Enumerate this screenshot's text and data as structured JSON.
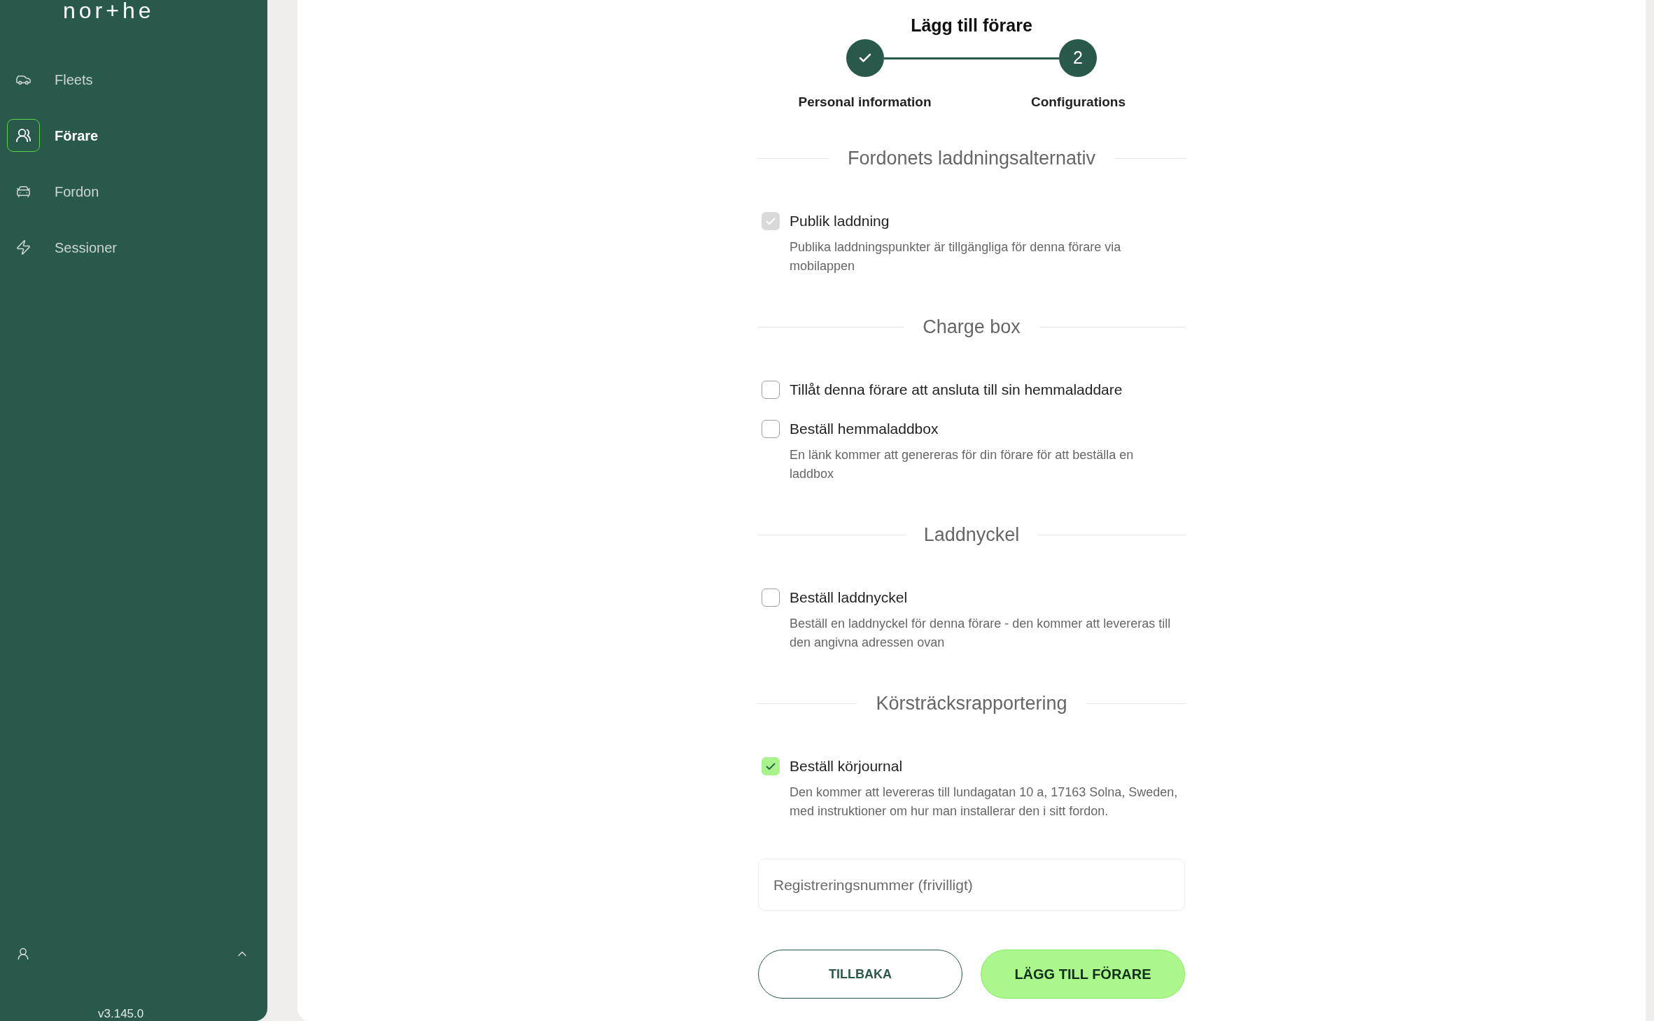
{
  "sidebar": {
    "logo": "nor+he",
    "items": [
      {
        "label": "Fleets",
        "selected": false
      },
      {
        "label": "Förare",
        "selected": true
      },
      {
        "label": "Fordon",
        "selected": false
      },
      {
        "label": "Sessioner",
        "selected": false
      }
    ],
    "version": "v3.145.0"
  },
  "form": {
    "title": "Lägg till förare",
    "steps": [
      {
        "label": "Personal information",
        "completed": true
      },
      {
        "label": "Configurations",
        "number": "2",
        "completed": false
      }
    ],
    "sections": [
      {
        "title": "Fordonets laddningsalternativ",
        "items": [
          {
            "label": "Publik laddning",
            "description": "Publika laddningspunkter är tillgängliga för denna förare via mobilappen",
            "checked": true,
            "disabled": true
          }
        ]
      },
      {
        "title": "Charge box",
        "items": [
          {
            "label": "Tillåt denna förare att ansluta till sin hemmaladdare",
            "checked": false,
            "disabled": false
          },
          {
            "label": "Beställ hemmaladdbox",
            "description": "En länk kommer att genereras för din förare för att beställa en laddbox",
            "checked": false,
            "disabled": false
          }
        ]
      },
      {
        "title": "Laddnyckel",
        "items": [
          {
            "label": "Beställ laddnyckel",
            "description": "Beställ en laddnyckel för denna förare - den kommer att levereras till den angivna adressen ovan",
            "checked": false,
            "disabled": false
          }
        ]
      },
      {
        "title": "Körsträcksrapportering",
        "items": [
          {
            "label": "Beställ körjournal",
            "description": "Den kommer att levereras till lundagatan 10 a, 17163 Solna, Sweden, med instruktioner om hur man installerar den i sitt fordon.",
            "checked": true,
            "disabled": false
          }
        ]
      }
    ],
    "registration_field": {
      "placeholder": "Registreringsnummer (frivilligt)"
    },
    "buttons": [
      {
        "label": "TILLBAKA",
        "kind": "secondary"
      },
      {
        "label": "LÄGG TILL FÖRARE",
        "kind": "primary"
      }
    ]
  }
}
